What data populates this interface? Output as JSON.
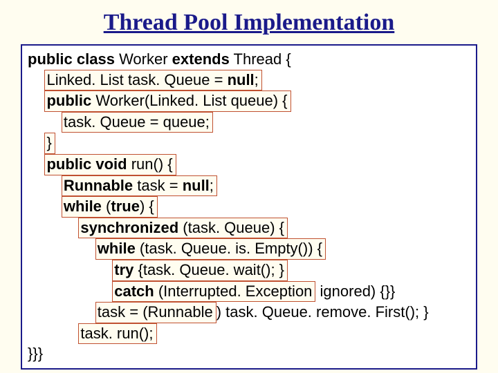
{
  "title": "Thread Pool Implementation",
  "code": {
    "l1a": "public class",
    "l1b": " Worker ",
    "l1c": "extends",
    "l1d": " Thread {",
    "l2a": "Linked. List task. Queue = ",
    "l2b": "null",
    "l2c": ";",
    "l3a": "public",
    "l3b": " Worker(Linked. List queue) {",
    "l4": "task. Queue = queue;",
    "l5": "}",
    "l6a": "public void",
    "l6b": " run() {",
    "l7a": "Runnable",
    "l7b": " task = ",
    "l7c": "null",
    "l7d": ";",
    "l8a": "while",
    "l8b": " (",
    "l8c": "true",
    "l8d": ") {",
    "l9a": "synchronized",
    "l9b": " (task. Queue) {",
    "l10a": "while",
    "l10b": " (task. Queue. is. Empty()) {",
    "l11a": "try",
    "l11b": " {task. Queue. wait(); }",
    "l12a": "catch",
    "l12b": " (Interrupted. Exception",
    "l12c": " ignored) {}}",
    "l13a": "task = (Runnable",
    "l13b": ") task. Queue. remove. First(); }",
    "l14": "task. run();",
    "l15": "}}}"
  }
}
